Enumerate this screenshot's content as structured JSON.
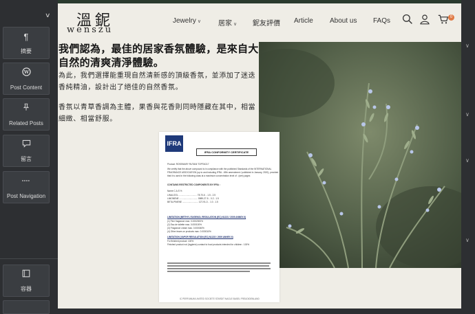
{
  "editor": {
    "widgets": [
      {
        "label": "摘要",
        "icon": "paragraph-icon",
        "glyph": "¶"
      },
      {
        "label": "Post Content",
        "icon": "wordpress-icon",
        "glyph": "W"
      },
      {
        "label": "Related Posts",
        "icon": "pin-icon",
        "glyph": "📌"
      },
      {
        "label": "留言",
        "icon": "comment-icon",
        "glyph": "💬"
      },
      {
        "label": "Post Navigation",
        "icon": "navigation-icon",
        "glyph": "⇔"
      },
      {
        "label": "容器",
        "icon": "container-icon",
        "glyph": "▣"
      }
    ]
  },
  "site": {
    "logo_zh": "溫鈮",
    "logo_en": "wenszu",
    "nav": {
      "jewelry": "Jewelry",
      "home": "居家",
      "reviews": "鈮友評價",
      "article": "Article",
      "about": "About us",
      "faqs": "FAQs"
    },
    "cart_count": "0",
    "accent_color": "#e07a45"
  },
  "content": {
    "title": "我們認為，最佳的居家香氛體驗，是來自大自然的清爽清淨體驗。",
    "para1": "為此，我們選擇能重現自然清新感的頂級香氛，並添加了迷迭香純精油，設計出了絕佳的自然香氛。",
    "para2": "香氛以青草香調為主體，果香與花香則同時隱藏在其中，相當細緻、相當舒服。"
  },
  "certificate": {
    "logo": "IFRA",
    "title": "IFRA CONFORMITY CERTIFICATE",
    "product": "Product: ROSEMARY RUTANI TOPTAG17",
    "intro1": "We certify that the above compound is in compliance with the published Standards of the INTERNATIONAL",
    "intro2": "FRAGRANCE ASSOCIATION (up to and including IFRA - 49th amendment / published in January, 2020), provided",
    "intro3": "that it is used in the following class at a maximum concentration level of : (see) pages",
    "restricted": "CONTAINS RESTRICTED COMPONENTS BY IFRA :",
    "col_header": "Name                    C.A.S         %",
    "row1": "LINALOOL ..............................  78-70-6 ..   1.5 - 2.5",
    "row2": "LIMONENE ..............................  5989-27-5 ..   0.2 - 1.5",
    "row3": "BETA-PINENE ..........................  127-91-3 ..   1.0 - 1.5",
    "section1": "LIMITATION (METHYL EUGENOL REGULATION (EC) N1223 / 2009 ANNEX II)",
    "s1a": "(1) Fine fragrance max. 0.0002000%",
    "s1b": "(2) Eau de toilette max. 0.000100%",
    "s1c": "(3) Fragrance cream max. 0.000040%",
    "s1d": "(4) Other leave-on products max. 0.000010%",
    "section2": "LIMITATION (VAPOR REGULATION (EC) N1223 / 2009 ANNEX II)",
    "s2a": "For finished product: 100%",
    "s2b": "Finished product not (hygienic) contact to food products intended for children :  100%",
    "footer": "IC PERFUMUM LIMITED SOCIETE STARDIT NAGLE BASEL FREUDIDENLAND"
  }
}
